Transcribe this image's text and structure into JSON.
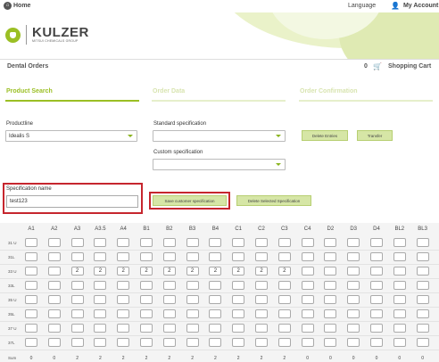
{
  "topbar": {
    "home_label": "Home",
    "language_label": "Language",
    "account_label": "My Account"
  },
  "header": {
    "brand_name": "KULZER",
    "brand_subtitle": "MITSUI CHEMICALS GROUP"
  },
  "nav": {
    "title": "Dental Orders",
    "cart_count": "0",
    "cart_label": "Shopping Cart"
  },
  "steps": [
    {
      "label": "Product Search",
      "active": true
    },
    {
      "label": "Order Data",
      "active": false
    },
    {
      "label": "Order Confirmation",
      "active": false
    }
  ],
  "form": {
    "productline_label": "Productline",
    "productline_value": "Idealis S",
    "standard_spec_label": "Standard specification",
    "standard_spec_value": "",
    "custom_spec_label": "Custom specification",
    "custom_spec_value": "",
    "delete_entries_label": "Delete Entries",
    "transfer_label": "Transfer",
    "spec_name_label": "Specification name",
    "spec_name_value": "test123",
    "save_custom_label": "Save customer specification",
    "delete_selected_label": "Delete Selected Specification"
  },
  "grid": {
    "columns": [
      "A1",
      "A2",
      "A3",
      "A3.5",
      "A4",
      "B1",
      "B2",
      "B3",
      "B4",
      "C1",
      "C2",
      "C3",
      "C4",
      "D2",
      "D3",
      "D4",
      "BL2",
      "BL3"
    ],
    "rows": [
      {
        "label": "31 U",
        "values": [
          "",
          "",
          "",
          "",
          "",
          "",
          "",
          "",
          "",
          "",
          "",
          "",
          "",
          "",
          "",
          "",
          "",
          ""
        ]
      },
      {
        "label": "31L",
        "values": [
          "",
          "",
          "",
          "",
          "",
          "",
          "",
          "",
          "",
          "",
          "",
          "",
          "",
          "",
          "",
          "",
          "",
          ""
        ]
      },
      {
        "label": "33 U",
        "values": [
          "",
          "",
          "2",
          "2",
          "2",
          "2",
          "2",
          "2",
          "2",
          "2",
          "2",
          "2",
          "",
          "",
          "",
          "",
          "",
          ""
        ]
      },
      {
        "label": "33L",
        "values": [
          "",
          "",
          "",
          "",
          "",
          "",
          "",
          "",
          "",
          "",
          "",
          "",
          "",
          "",
          "",
          "",
          "",
          ""
        ]
      },
      {
        "label": "35 U",
        "values": [
          "",
          "",
          "",
          "",
          "",
          "",
          "",
          "",
          "",
          "",
          "",
          "",
          "",
          "",
          "",
          "",
          "",
          ""
        ]
      },
      {
        "label": "35L",
        "values": [
          "",
          "",
          "",
          "",
          "",
          "",
          "",
          "",
          "",
          "",
          "",
          "",
          "",
          "",
          "",
          "",
          "",
          ""
        ]
      },
      {
        "label": "37 U",
        "values": [
          "",
          "",
          "",
          "",
          "",
          "",
          "",
          "",
          "",
          "",
          "",
          "",
          "",
          "",
          "",
          "",
          "",
          ""
        ]
      },
      {
        "label": "37L",
        "values": [
          "",
          "",
          "",
          "",
          "",
          "",
          "",
          "",
          "",
          "",
          "",
          "",
          "",
          "",
          "",
          "",
          "",
          ""
        ]
      }
    ],
    "sum_label": "Sum",
    "sums": [
      "0",
      "0",
      "2",
      "2",
      "2",
      "2",
      "2",
      "2",
      "2",
      "2",
      "2",
      "2",
      "0",
      "0",
      "0",
      "0",
      "0",
      "0"
    ]
  },
  "colors": {
    "accent": "#9bbf24",
    "highlight": "#c6262e",
    "button": "#d6e6a6"
  }
}
